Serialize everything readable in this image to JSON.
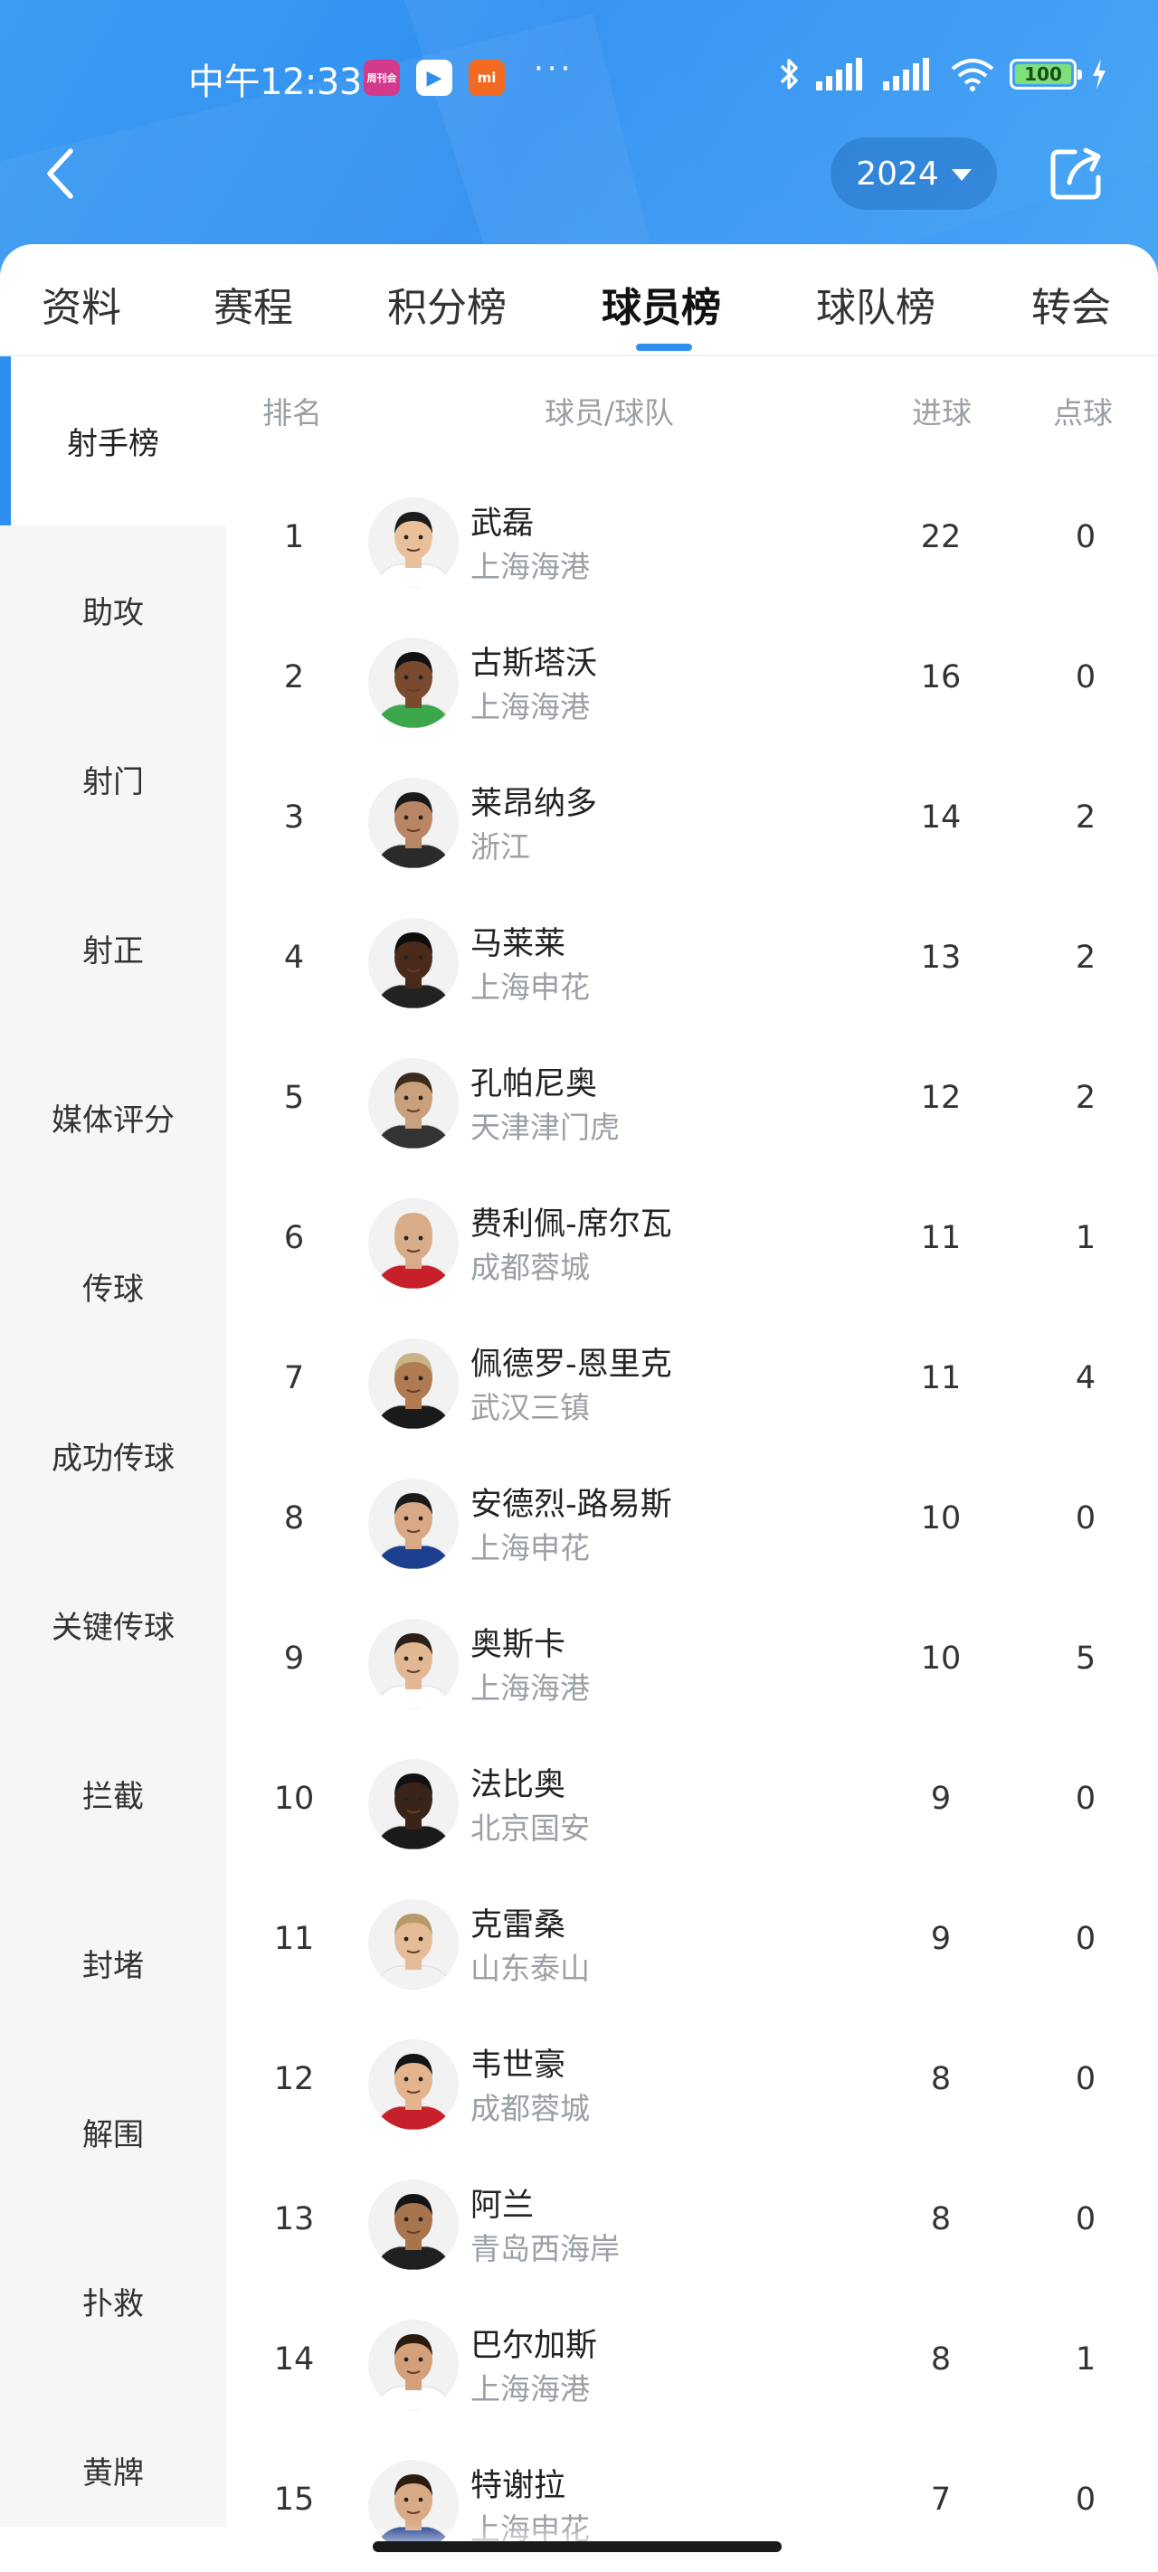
{
  "status_bar": {
    "time": "中午12:33",
    "battery": "100",
    "apps": [
      "周刊会",
      "▶",
      "mi"
    ],
    "more": "···"
  },
  "header": {
    "year": "2024"
  },
  "tabs": [
    {
      "label": "资料"
    },
    {
      "label": "赛程"
    },
    {
      "label": "积分榜"
    },
    {
      "label": "球员榜"
    },
    {
      "label": "球队榜"
    },
    {
      "label": "转会"
    }
  ],
  "active_tab": "球员榜",
  "side_menu": [
    {
      "label": "射手榜"
    },
    {
      "label": "助攻"
    },
    {
      "label": "射门"
    },
    {
      "label": "射正"
    },
    {
      "label": "媒体评分"
    },
    {
      "label": "传球"
    },
    {
      "label": "成功传球"
    },
    {
      "label": "关键传球"
    },
    {
      "label": "拦截"
    },
    {
      "label": "封堵"
    },
    {
      "label": "解围"
    },
    {
      "label": "扑救"
    },
    {
      "label": "黄牌"
    }
  ],
  "table": {
    "headers": {
      "rank": "排名",
      "player": "球员/球队",
      "goals": "进球",
      "penalties": "点球"
    },
    "rows": [
      {
        "rank": "1",
        "name": "武磊",
        "team": "上海海港",
        "goals": "22",
        "penalties": "0",
        "skin": "#e9c09a",
        "hair": "#1b1b1b",
        "shirt": "#ffffff"
      },
      {
        "rank": "2",
        "name": "古斯塔沃",
        "team": "上海海港",
        "goals": "16",
        "penalties": "0",
        "skin": "#7a4a2e",
        "hair": "#111111",
        "shirt": "#3aa84a"
      },
      {
        "rank": "3",
        "name": "莱昂纳多",
        "team": "浙江",
        "goals": "14",
        "penalties": "2",
        "skin": "#b88664",
        "hair": "#1a1a1a",
        "shirt": "#2a2a2a"
      },
      {
        "rank": "4",
        "name": "马莱莱",
        "team": "上海申花",
        "goals": "13",
        "penalties": "2",
        "skin": "#4a2a1a",
        "hair": "#0d0d0d",
        "shirt": "#222222"
      },
      {
        "rank": "5",
        "name": "孔帕尼奥",
        "team": "天津津门虎",
        "goals": "12",
        "penalties": "2",
        "skin": "#c8a07c",
        "hair": "#3a2a1c",
        "shirt": "#333333"
      },
      {
        "rank": "6",
        "name": "费利佩-席尔瓦",
        "team": "成都蓉城",
        "goals": "11",
        "penalties": "1",
        "skin": "#d8ac88",
        "hair": "#d8ac88",
        "shirt": "#c8202a"
      },
      {
        "rank": "7",
        "name": "佩德罗-恩里克",
        "team": "武汉三镇",
        "goals": "11",
        "penalties": "4",
        "skin": "#b07a52",
        "hair": "#c9b48a",
        "shirt": "#1a1a1a"
      },
      {
        "rank": "8",
        "name": "安德烈-路易斯",
        "team": "上海申花",
        "goals": "10",
        "penalties": "0",
        "skin": "#d9a884",
        "hair": "#1a1a1a",
        "shirt": "#1d3f8f"
      },
      {
        "rank": "9",
        "name": "奥斯卡",
        "team": "上海海港",
        "goals": "10",
        "penalties": "5",
        "skin": "#e2b894",
        "hair": "#2a2018",
        "shirt": "#ffffff"
      },
      {
        "rank": "10",
        "name": "法比奥",
        "team": "北京国安",
        "goals": "9",
        "penalties": "0",
        "skin": "#3a2418",
        "hair": "#111111",
        "shirt": "#1a1a1a"
      },
      {
        "rank": "11",
        "name": "克雷桑",
        "team": "山东泰山",
        "goals": "9",
        "penalties": "0",
        "skin": "#e6bc98",
        "hair": "#b89a6a",
        "shirt": "#f2f2f2"
      },
      {
        "rank": "12",
        "name": "韦世豪",
        "team": "成都蓉城",
        "goals": "8",
        "penalties": "0",
        "skin": "#e3b48e",
        "hair": "#141414",
        "shirt": "#c8202a"
      },
      {
        "rank": "13",
        "name": "阿兰",
        "team": "青岛西海岸",
        "goals": "8",
        "penalties": "0",
        "skin": "#a8744e",
        "hair": "#141414",
        "shirt": "#202020"
      },
      {
        "rank": "14",
        "name": "巴尔加斯",
        "team": "上海海港",
        "goals": "8",
        "penalties": "1",
        "skin": "#d4a07a",
        "hair": "#2a1a10",
        "shirt": "#ffffff"
      },
      {
        "rank": "15",
        "name": "特谢拉",
        "team": "上海申花",
        "goals": "7",
        "penalties": "0",
        "skin": "#d8aa86",
        "hair": "#2a1a10",
        "shirt": "#1d3f8f"
      }
    ]
  },
  "colors": {
    "accent": "#2f8ff0",
    "header_bg": "#3a98f2",
    "muted_text": "#9aa0a6",
    "side_bg": "#f5f6f8"
  }
}
